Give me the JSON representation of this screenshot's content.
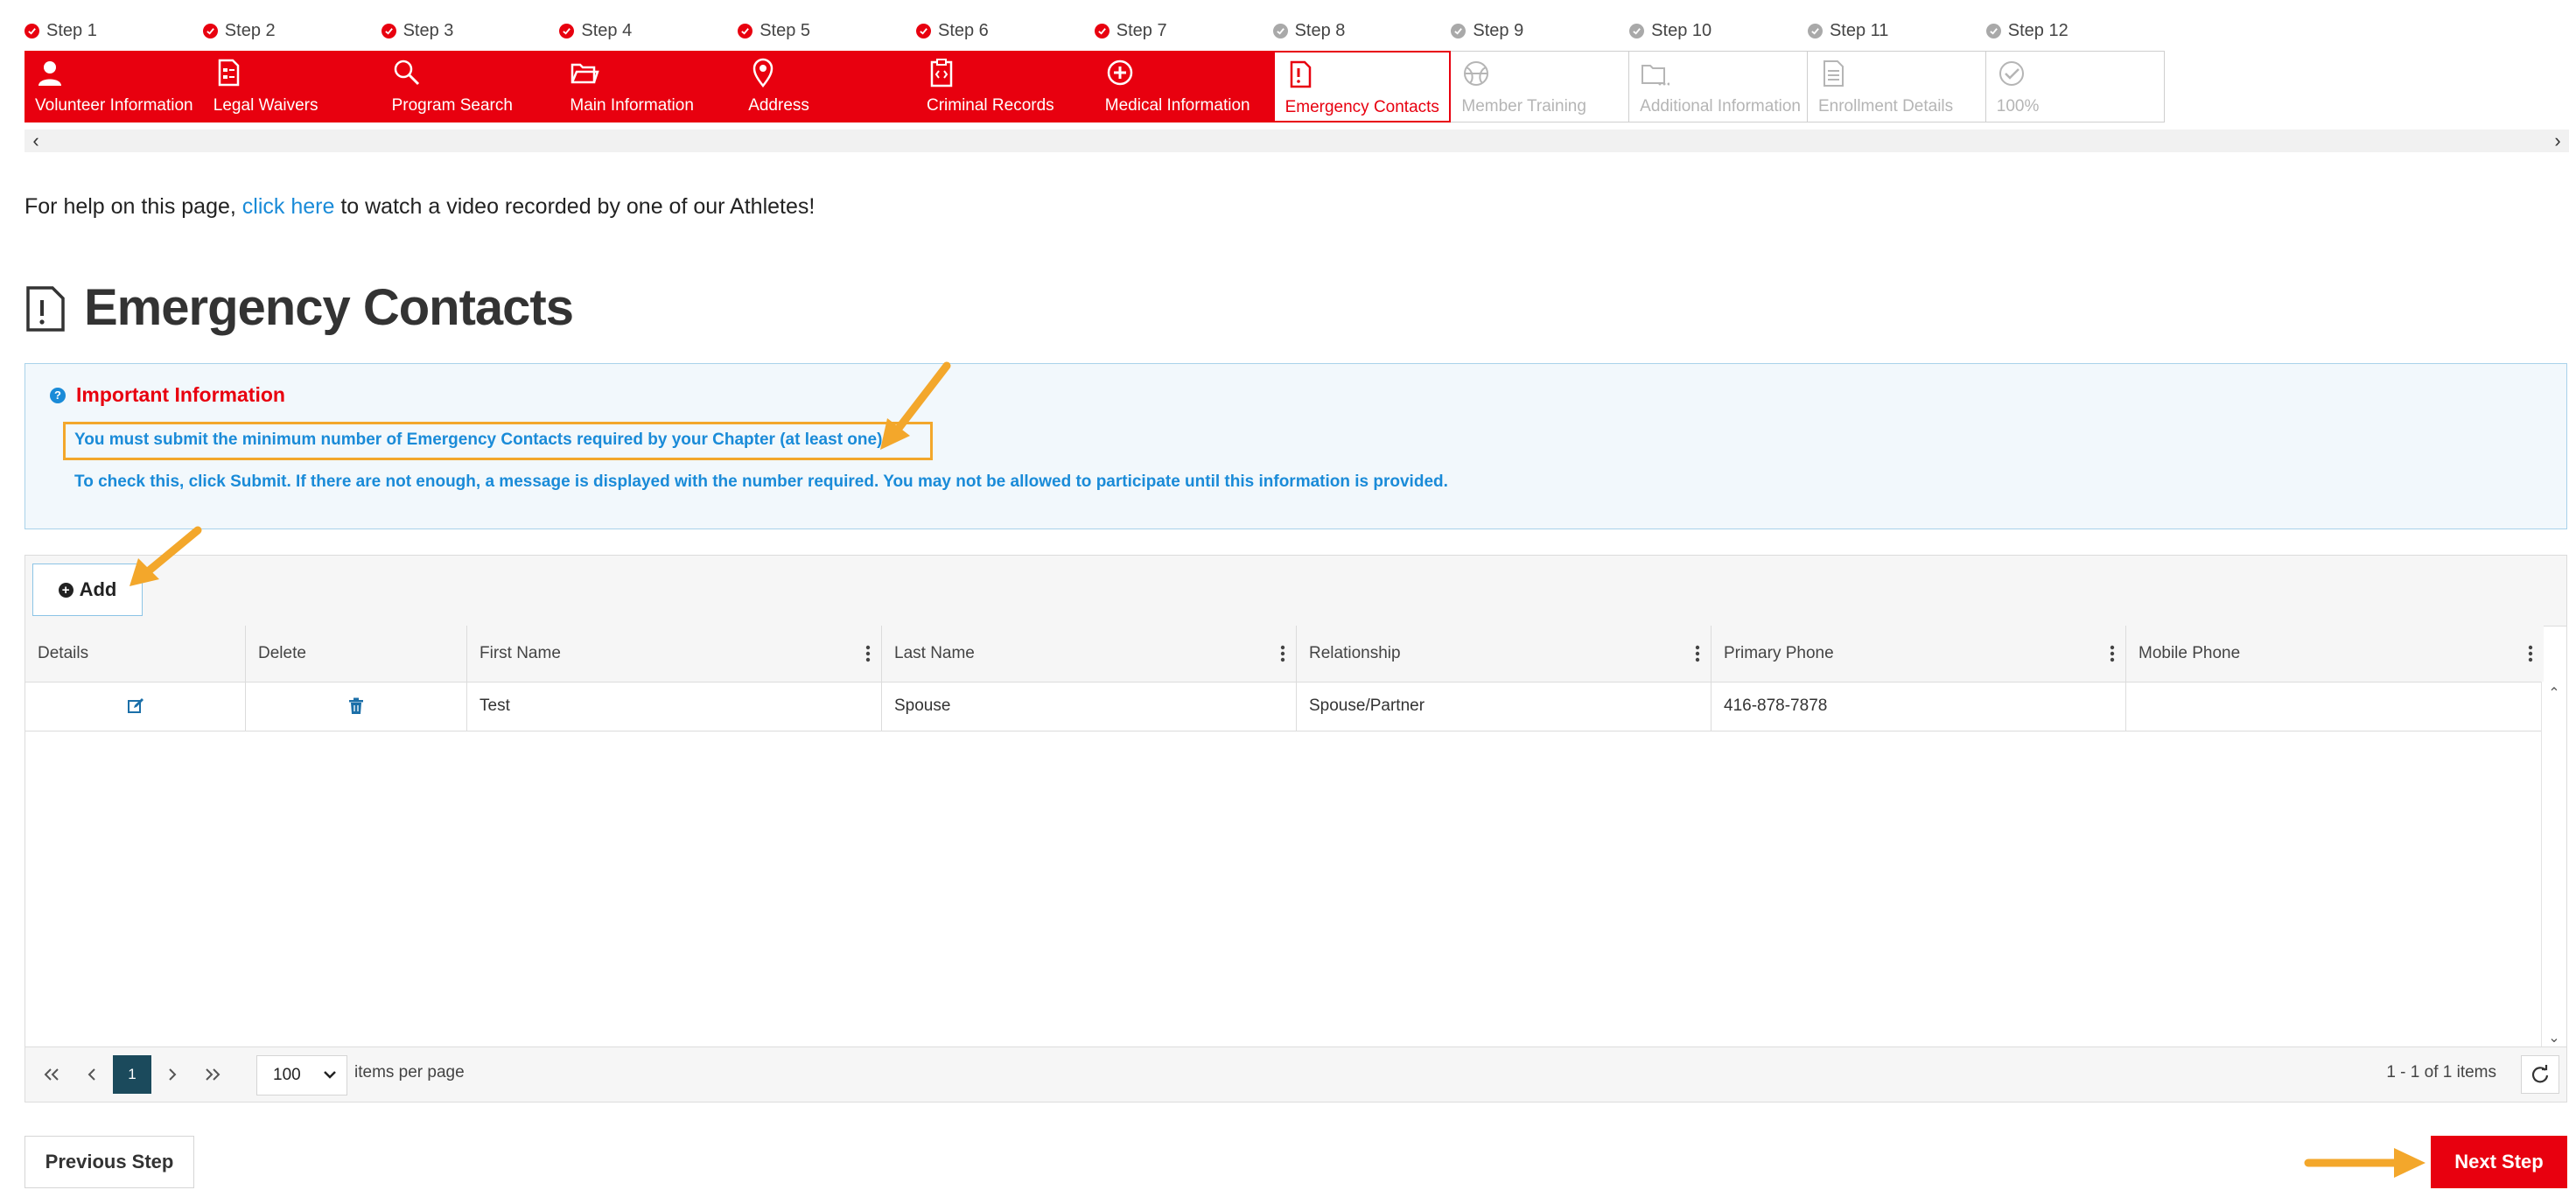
{
  "stepper": {
    "steps": [
      {
        "step": "Step 1",
        "label": "Volunteer Information",
        "state": "done",
        "icon": "person-icon"
      },
      {
        "step": "Step 2",
        "label": "Legal Waivers",
        "state": "done",
        "icon": "document-icon"
      },
      {
        "step": "Step 3",
        "label": "Program Search",
        "state": "done",
        "icon": "search-icon"
      },
      {
        "step": "Step 4",
        "label": "Main Information",
        "state": "done",
        "icon": "folder-icon"
      },
      {
        "step": "Step 5",
        "label": "Address",
        "state": "done",
        "icon": "map-pin-icon"
      },
      {
        "step": "Step 6",
        "label": "Criminal Records",
        "state": "done",
        "icon": "clipboard-icon"
      },
      {
        "step": "Step 7",
        "label": "Medical Information",
        "state": "done",
        "icon": "plus-circle-icon"
      },
      {
        "step": "Step 8",
        "label": "Emergency Contacts",
        "state": "current",
        "icon": "alert-document-icon"
      },
      {
        "step": "Step 9",
        "label": "Member Training",
        "state": "todo",
        "icon": "ball-icon"
      },
      {
        "step": "Step 10",
        "label": "Additional Information",
        "state": "todo",
        "icon": "folder-dots-icon"
      },
      {
        "step": "Step 11",
        "label": "Enrollment Details",
        "state": "todo",
        "icon": "document-lines-icon"
      },
      {
        "step": "Step 12",
        "label": "100%",
        "state": "todo",
        "icon": "check-circle-icon"
      }
    ]
  },
  "help": {
    "prefix": "For help on this page, ",
    "link": "click here",
    "suffix": " to watch a video recorded by one of our Athletes!"
  },
  "page": {
    "title": "Emergency Contacts"
  },
  "info": {
    "heading": "Important Information",
    "line1": "You must submit the minimum number of Emergency Contacts required by your Chapter (at least one).",
    "line2": "To check this, click Submit.  If there are not enough, a message is displayed with the number required. You may not be allowed to participate until this information is provided."
  },
  "grid": {
    "add_label": "Add",
    "columns": [
      "Details",
      "Delete",
      "First Name",
      "Last Name",
      "Relationship",
      "Primary Phone",
      "Mobile Phone"
    ],
    "rows": [
      {
        "first_name": "Test",
        "last_name": "Spouse",
        "relationship": "Spouse/Partner",
        "primary_phone": "416-878-7878",
        "mobile_phone": ""
      }
    ],
    "pager": {
      "current_page": "1",
      "page_size": "100",
      "items_per_page_label": "items per page",
      "summary": "1 - 1 of 1 items"
    }
  },
  "footer": {
    "previous_label": "Previous Step",
    "next_label": "Next Step"
  },
  "colors": {
    "brand_red": "#e8000f",
    "link_blue": "#1a8bd8",
    "annotation_orange": "#f3a72b",
    "pager_active": "#1b4a5c"
  }
}
